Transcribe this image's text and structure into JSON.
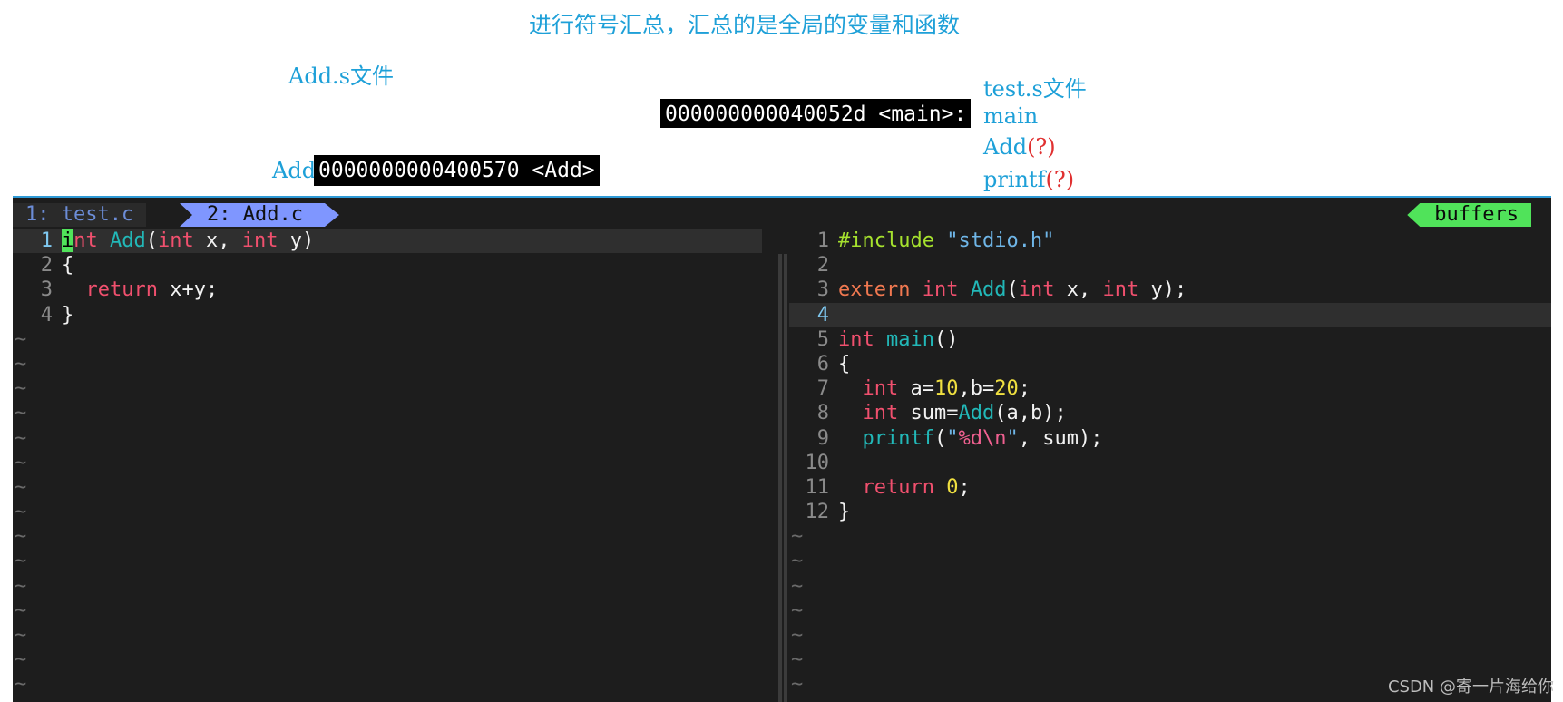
{
  "annotations": {
    "title": "进行符号汇总，汇总的是全局的变量和函数",
    "add_s_file": "Add.s文件",
    "test_s_file": "test.s文件",
    "add_label": "Add",
    "main_sym": "main",
    "add_sym": "Add",
    "printf_sym": "printf",
    "question_mark": "(?)",
    "main_addr": "000000000040052d <main>:",
    "add_addr": "0000000000400570 <Add>"
  },
  "tabline": {
    "tab1": "1: test.c",
    "tab2": "2: Add.c",
    "buffers": "buffers"
  },
  "left_pane": {
    "file": "Add.c",
    "line_numbers": [
      "1",
      "2",
      "3",
      "4"
    ],
    "tilde_rows": 15
  },
  "right_pane": {
    "file": "test.c",
    "line_numbers": [
      "1",
      "2",
      "3",
      "4",
      "5",
      "6",
      "7",
      "8",
      "9",
      "10",
      "11",
      "12"
    ],
    "current_line": "4",
    "tilde_rows": 7
  },
  "code": {
    "kw_int": "int",
    "kw_return": "return",
    "kw_extern": "extern",
    "fn_add": "Add",
    "fn_main": "main",
    "fn_printf": "printf",
    "include": "#include",
    "include_file": "\"stdio.h\"",
    "fmt_quote_open": "\"",
    "fmt_body": "%d\\n",
    "fmt_quote_close": "\"",
    "num_10": "10",
    "num_20": "20",
    "num_0": "0"
  },
  "watermark": "CSDN @寄一片海给你",
  "colors": {
    "editor_bg": "#1d1d1d",
    "annotation_blue": "#1ea0d8",
    "question_red": "#e03030",
    "tab_active": "#7f96ff",
    "buffers_green": "#50e35a"
  }
}
